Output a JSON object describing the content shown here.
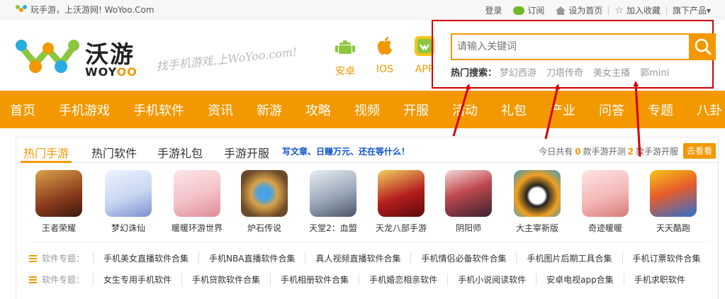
{
  "topbar": {
    "slogan": "玩手游，上沃游网! WoYoo.Com",
    "login": "登录",
    "subscribe": "订阅",
    "set_home": "设为首页",
    "favorite": "加入收藏",
    "products": "旗下产品▾"
  },
  "header": {
    "logo_cn": "沃游",
    "logo_en_1": "WOY",
    "logo_en_2": "OO",
    "tagline": "找手机游戏,上WoYoo.com!",
    "platforms": [
      {
        "label": "安卓",
        "icon": "android-icon"
      },
      {
        "label": "IOS",
        "icon": "apple-icon"
      },
      {
        "label": "APP",
        "icon": "app-icon"
      }
    ]
  },
  "search": {
    "placeholder": "请输入关键词",
    "hot_label": "热门搜索：",
    "hot_terms": [
      "梦幻西游",
      "刀塔传奇",
      "美女主播",
      "郭mini"
    ]
  },
  "nav": [
    "首页",
    "手机游戏",
    "手机软件",
    "资讯",
    "新游",
    "攻略",
    "视频",
    "开服",
    "活动",
    "礼包",
    "产业",
    "问答",
    "专题",
    "八卦"
  ],
  "tabs": [
    "热门手游",
    "热门软件",
    "手游礼包",
    "手游开服"
  ],
  "promo": "写文章、日赚万元、还在等什么！",
  "today": {
    "prefix": "今日共有",
    "test_count": "0",
    "middle": "款手游开测",
    "open_count": "2",
    "suffix": "款手游开服"
  },
  "look_button": "去看看",
  "games": [
    {
      "name": "王者荣耀",
      "color": "#8a3a1c"
    },
    {
      "name": "梦幻诛仙",
      "color": "#c8d6f2"
    },
    {
      "name": "暖暖环游世界",
      "color": "#f3c1c6"
    },
    {
      "name": "炉石传说",
      "color": "#6b4a2a"
    },
    {
      "name": "天堂2：血盟",
      "color": "#9aa8b8"
    },
    {
      "name": "天龙八部手游",
      "color": "#b51e1e"
    },
    {
      "name": "阴阳师",
      "color": "#3a2230"
    },
    {
      "name": "大主宰新版",
      "color": "#f0a020"
    },
    {
      "name": "奇迹暖暖",
      "color": "#f4b8b8"
    },
    {
      "name": "天天酷跑",
      "color": "#2a6fd0"
    }
  ],
  "topics": [
    {
      "label": "软件专题：",
      "items": [
        "手机美女直播软件合集",
        "手机NBA直播软件合集",
        "真人视频直播软件合集",
        "手机情侣必备软件合集",
        "手机图片后期工具合集",
        "手机订票软件合集"
      ]
    },
    {
      "label": "软件专题：",
      "items": [
        "女生专用手机软件",
        "手机贷款软件合集",
        "手机相册软件合集",
        "手机婚恋相亲软件",
        "手机小说阅读软件",
        "安卓电视app合集",
        "手机求职软件"
      ]
    }
  ],
  "colors": {
    "accent": "#f39800",
    "annotation": "#d40000",
    "promo": "#1155cc"
  }
}
